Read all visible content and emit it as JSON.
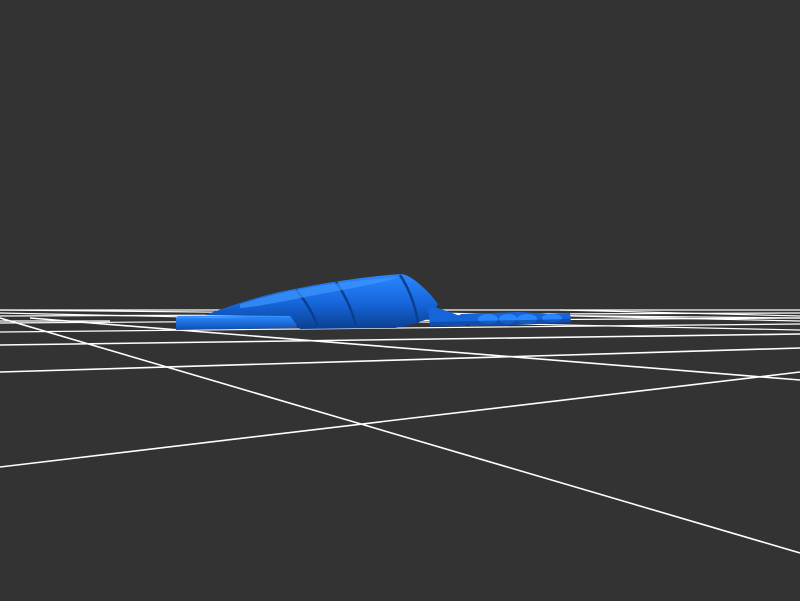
{
  "scene": {
    "background_color": "#333333",
    "grid_color": "#ffffff",
    "model_color": "#1565d8",
    "model_highlight_color": "#2a86ff",
    "model_shadow_color": "#0b3f8f"
  }
}
